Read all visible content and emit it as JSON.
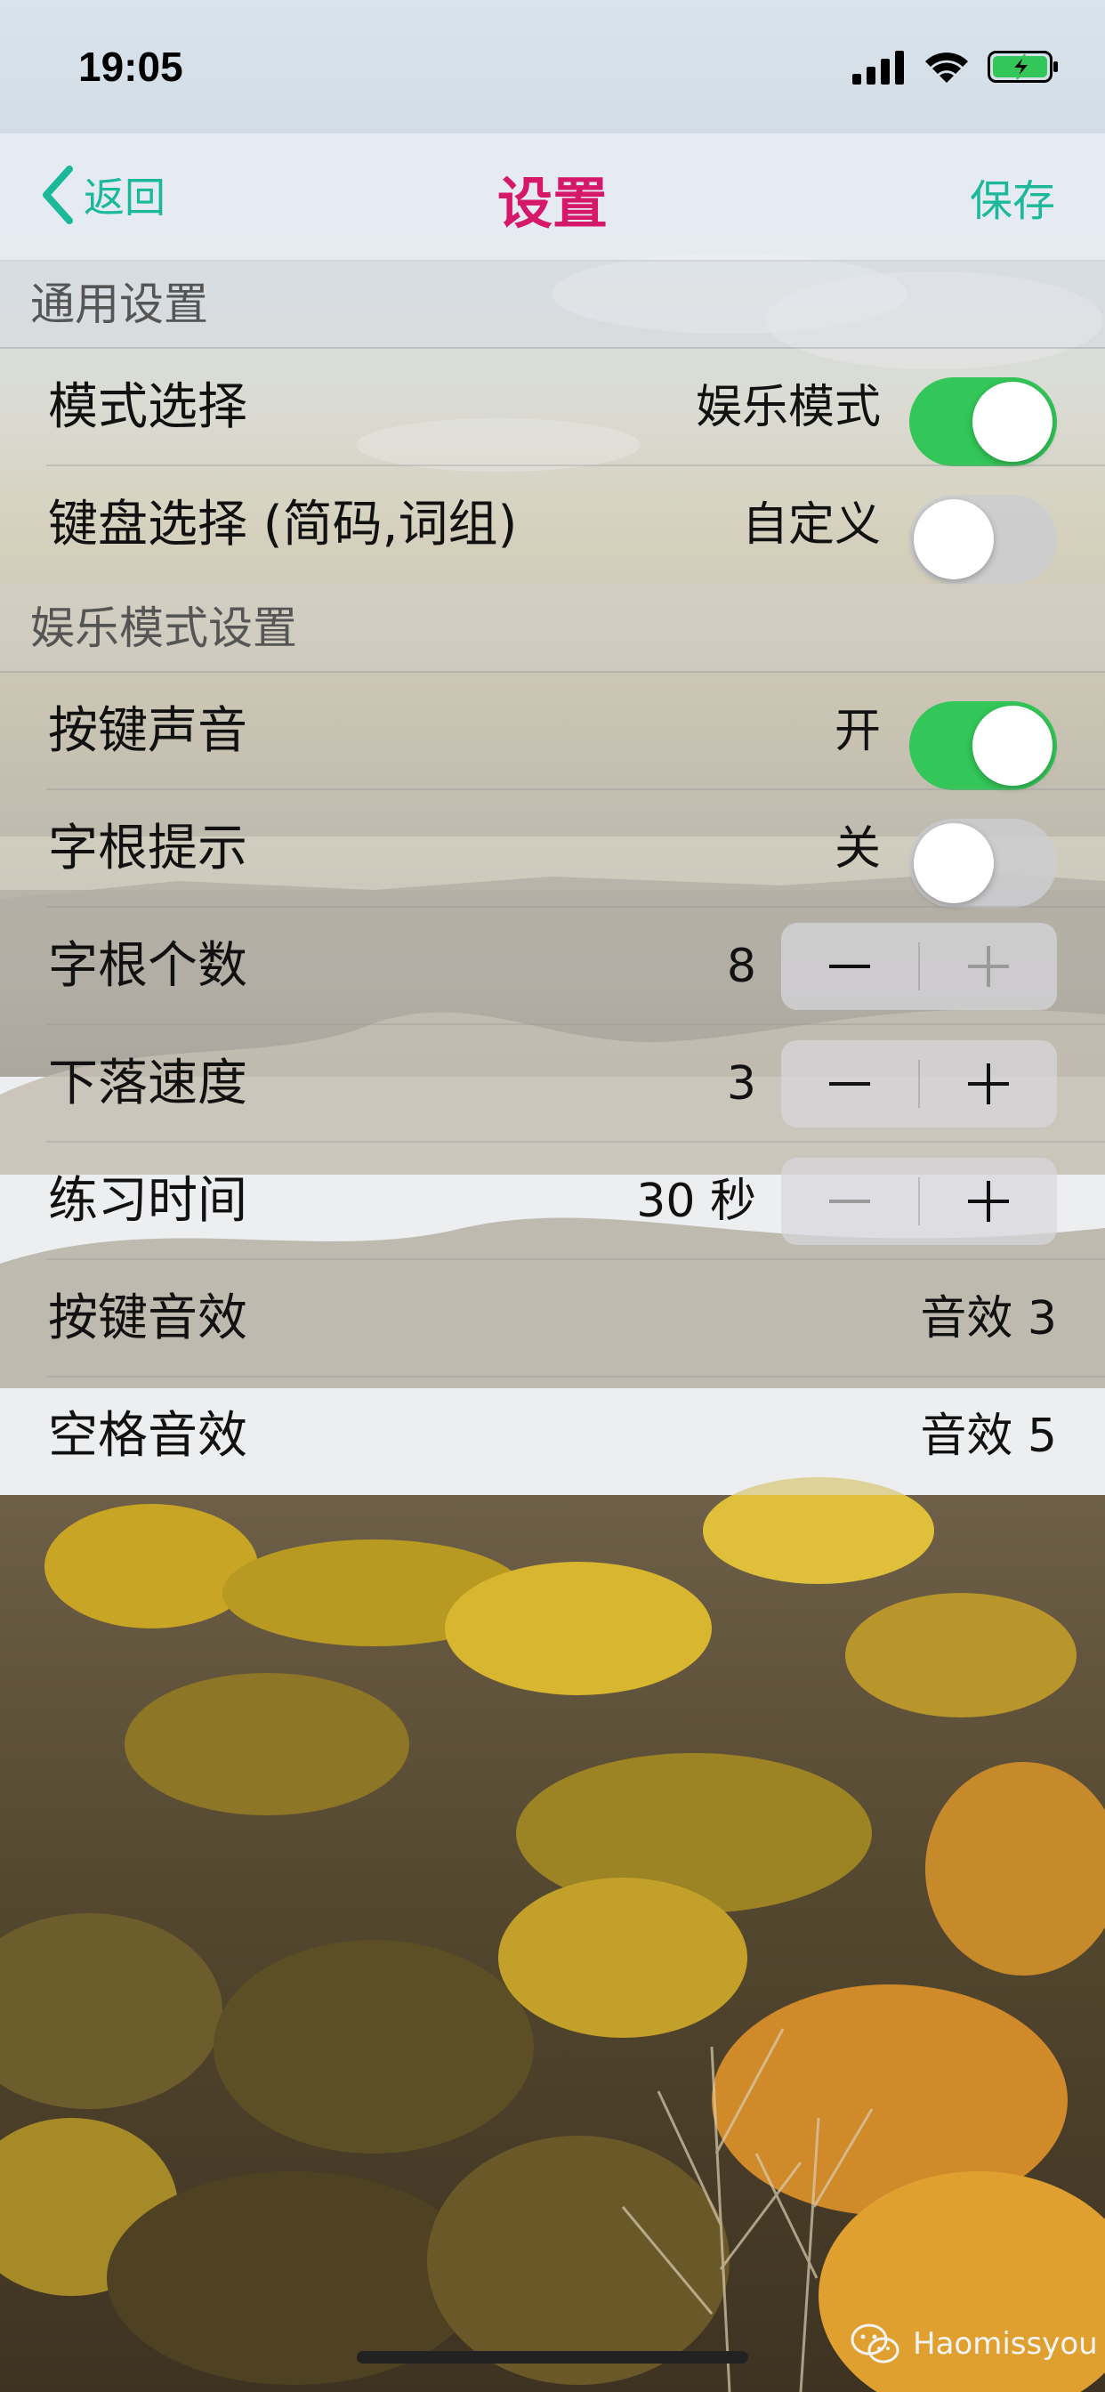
{
  "status_bar": {
    "time": "19:05"
  },
  "nav": {
    "back_label": "返回",
    "title": "设置",
    "save_label": "保存"
  },
  "sections": {
    "general": {
      "header": "通用设置"
    },
    "entertainment": {
      "header": "娱乐模式设置"
    }
  },
  "rows": {
    "mode": {
      "label": "模式选择",
      "value": "娱乐模式",
      "toggle_on": true
    },
    "keyboard": {
      "label": "键盘选择 (简码,词组)",
      "value": "自定义",
      "toggle_on": false
    },
    "key_sound": {
      "label": "按键声音",
      "value": "开",
      "toggle_on": true
    },
    "radical_hint": {
      "label": "字根提示",
      "value": "关",
      "toggle_on": false
    },
    "radical_count": {
      "label": "字根个数",
      "value": "8"
    },
    "fall_speed": {
      "label": "下落速度",
      "value": "3"
    },
    "practice_time": {
      "label": "练习时间",
      "value": "30 秒"
    },
    "key_effect": {
      "label": "按键音效",
      "value": "音效 3"
    },
    "space_effect": {
      "label": "空格音效",
      "value": "音效 5"
    }
  },
  "watermark": {
    "text": "Haomissyou"
  },
  "colors": {
    "accent": "#1bb89a",
    "title": "#d6186a",
    "toggle_on": "#33c658"
  },
  "icons": [
    "chevron-left-icon",
    "signal-icon",
    "wifi-icon",
    "battery-charging-icon",
    "minus-icon",
    "plus-icon",
    "wechat-icon"
  ]
}
